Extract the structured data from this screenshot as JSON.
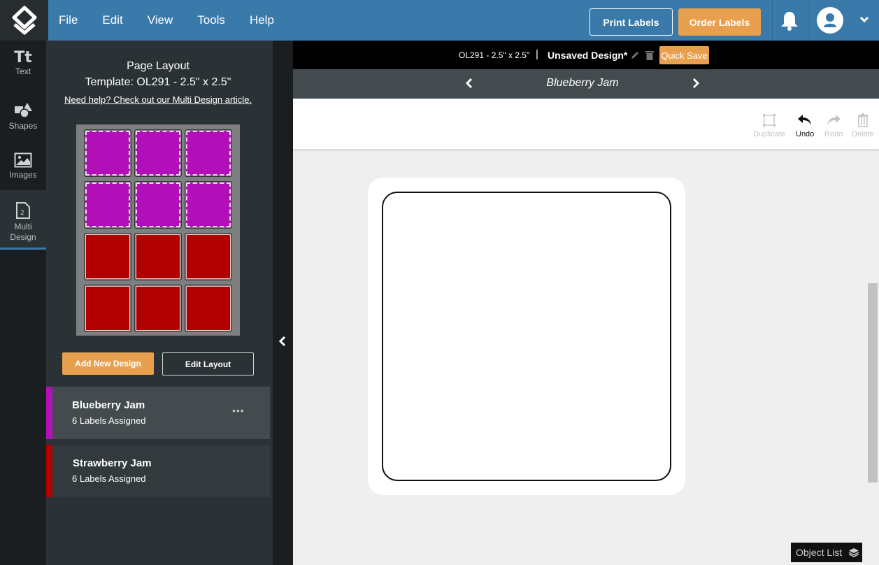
{
  "menu": {
    "items": [
      "File",
      "Edit",
      "View",
      "Tools",
      "Help"
    ]
  },
  "header": {
    "print_label": "Print Labels",
    "order_label": "Order Labels",
    "colors": {
      "brand": "#3a7aab",
      "accent": "#e9a04e"
    }
  },
  "rail": {
    "items": [
      {
        "label": "Text",
        "icon": "text-icon"
      },
      {
        "label": "Shapes",
        "icon": "shapes-icon"
      },
      {
        "label": "Images",
        "icon": "image-icon"
      },
      {
        "label": "Multi Design",
        "icon": "multi-design-icon",
        "badge": "2",
        "active": true
      }
    ]
  },
  "panel": {
    "title": "Page Layout",
    "template": "Template: OL291 - 2.5\" x 2.5\"",
    "help_link": "Need help? Check out our Multi Design article.",
    "sheet": {
      "rows": 4,
      "cols": 3,
      "cells": [
        "blueberry",
        "blueberry",
        "blueberry",
        "blueberry",
        "blueberry",
        "blueberry",
        "strawberry",
        "strawberry",
        "strawberry",
        "strawberry",
        "strawberry",
        "strawberry"
      ]
    },
    "add_button": "Add New Design",
    "edit_button": "Edit Layout",
    "designs": [
      {
        "name": "Blueberry Jam",
        "assigned": "6 Labels Assigned",
        "color": "#b30fb8",
        "selected": true
      },
      {
        "name": "Strawberry Jam",
        "assigned": "6 Labels Assigned",
        "color": "#b20000",
        "selected": false
      }
    ]
  },
  "infobar": {
    "template": "OL291 - 2.5\" x 2.5\"",
    "separator": "|",
    "design_name": "Unsaved Design*",
    "quick_save": "Quick Save"
  },
  "navbar": {
    "current_design": "Blueberry Jam"
  },
  "toolbar": {
    "duplicate": "Duplicate",
    "undo": "Undo",
    "redo": "Redo",
    "delete": "Delete"
  },
  "object_list": "Object List"
}
